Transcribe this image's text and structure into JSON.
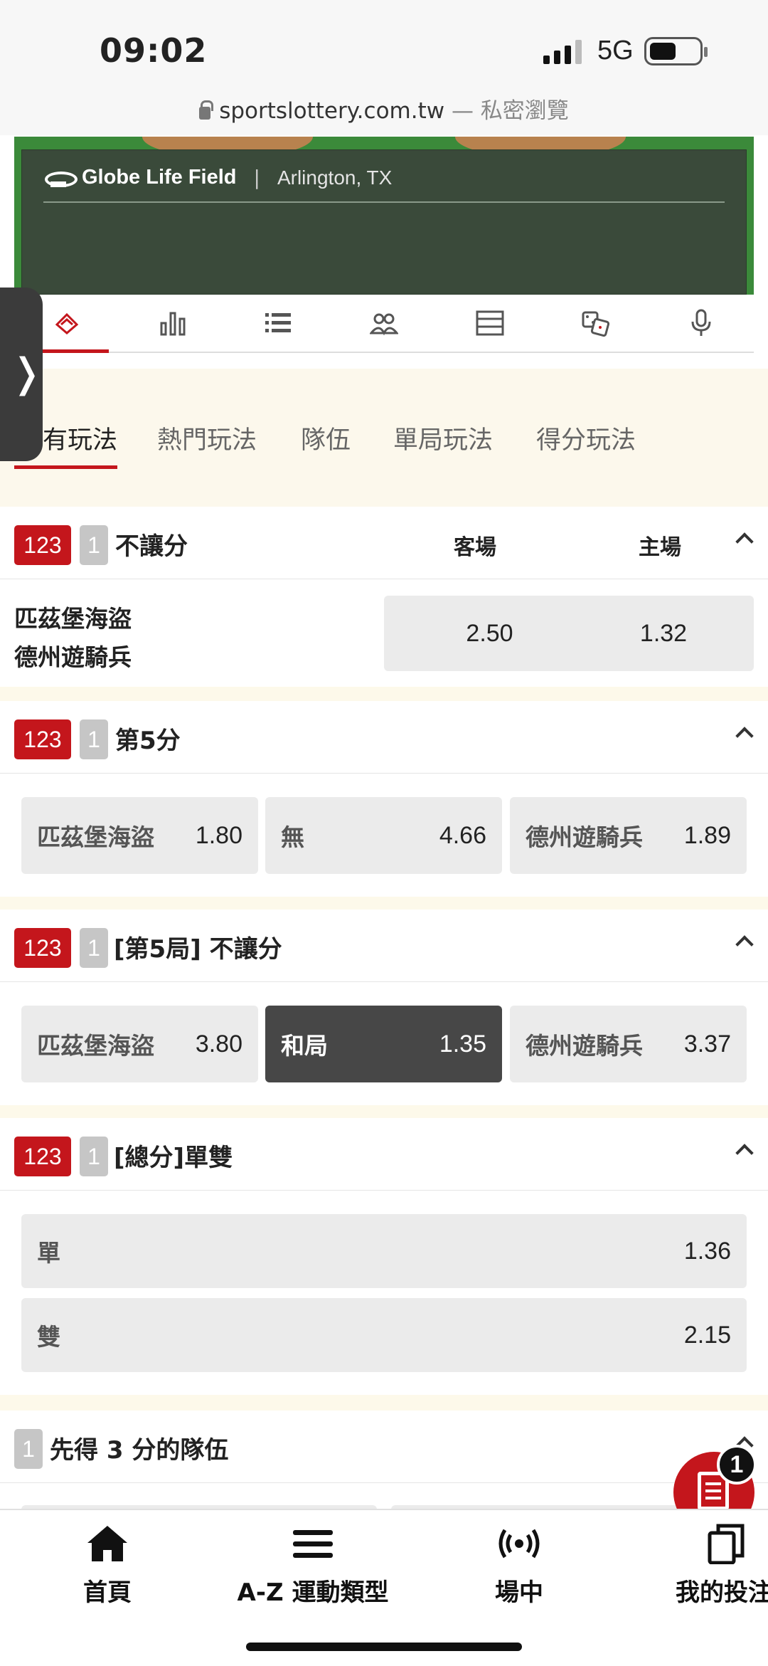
{
  "status_bar": {
    "time": "09:02",
    "network": "5G"
  },
  "browser": {
    "url": "sportslottery.com.tw",
    "mode": " — 私密瀏覽"
  },
  "venue": {
    "name": "Globe Life Field",
    "separator": "|",
    "location": "Arlington, TX"
  },
  "icon_tabs": [
    "field-icon",
    "stats-icon",
    "list-icon",
    "lineup-icon",
    "table-icon",
    "dice-icon",
    "mic-icon"
  ],
  "subtabs": [
    "有玩法",
    "熱門玩法",
    "隊伍",
    "單局玩法",
    "得分玩法"
  ],
  "badges": {
    "code": "123",
    "one": "1"
  },
  "sections": {
    "moneyline": {
      "title": "不讓分",
      "away_header": "客場",
      "home_header": "主場",
      "team_away": "匹茲堡海盜",
      "team_home": "德州遊騎兵",
      "away_odds": "2.50",
      "home_odds": "1.32"
    },
    "fifth_run": {
      "title": "第5分",
      "options": [
        {
          "label": "匹茲堡海盜",
          "odds": "1.80"
        },
        {
          "label": "無",
          "odds": "4.66"
        },
        {
          "label": "德州遊騎兵",
          "odds": "1.89"
        }
      ]
    },
    "inning5": {
      "title": "[第5局] 不讓分",
      "options": [
        {
          "label": "匹茲堡海盜",
          "odds": "3.80"
        },
        {
          "label": "和局",
          "odds": "1.35"
        },
        {
          "label": "德州遊騎兵",
          "odds": "3.37"
        }
      ]
    },
    "odd_even": {
      "title": "[總分]單雙",
      "options": [
        {
          "label": "單",
          "odds": "1.36"
        },
        {
          "label": "雙",
          "odds": "2.15"
        }
      ]
    },
    "first3": {
      "title": "先得 3 分的隊伍"
    }
  },
  "bottom_nav": {
    "home": "首頁",
    "sports": "A-Z 運動類型",
    "live": "場中",
    "mybets": "我的投注"
  },
  "bet_slip": {
    "count": "1"
  },
  "colors": {
    "accent": "#c4161c",
    "selected": "#474747",
    "band": "#fdf9ea"
  }
}
